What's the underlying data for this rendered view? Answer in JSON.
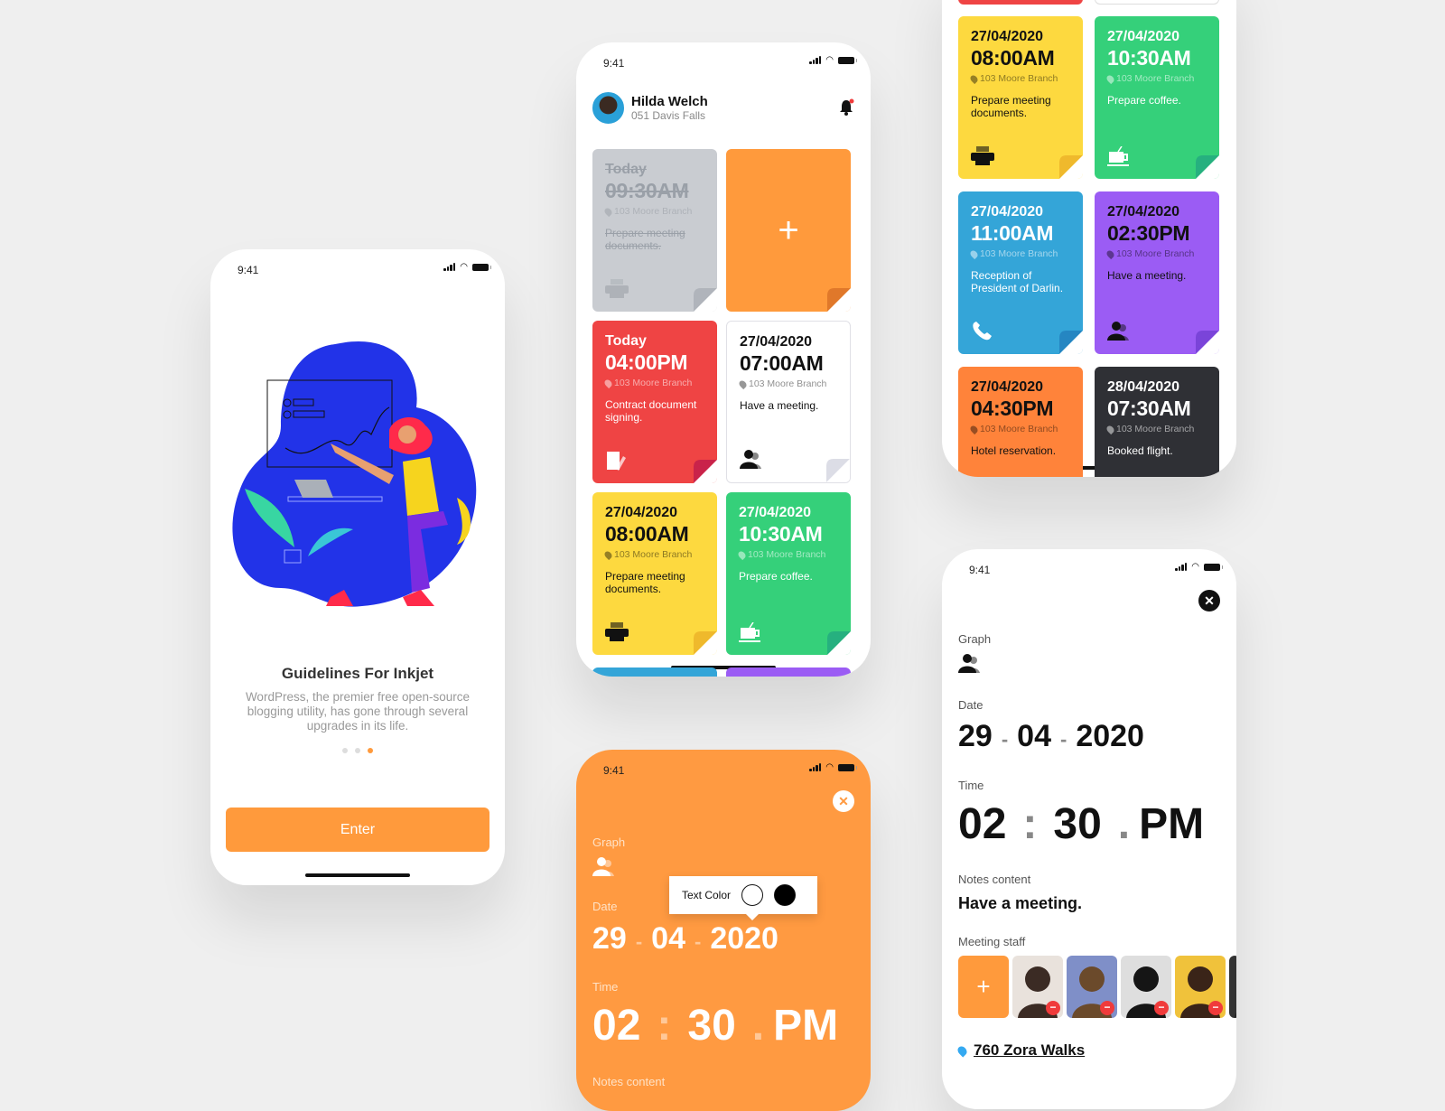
{
  "status_time": "9:41",
  "onboarding": {
    "title": "Guidelines For Inkjet",
    "description": "WordPress, the premier free open-source blogging utility, has gone through several upgrades in its life.",
    "page_indicator": {
      "total": 3,
      "active": 3
    },
    "enter_label": "Enter",
    "accent": "#ff9a3c"
  },
  "home": {
    "user_name": "Hilda Welch",
    "user_address": "051 Davis Falls",
    "notification_badge_color": "#f03b3b",
    "add_label": "+",
    "cards": [
      {
        "date": "Today",
        "time": "09:30AM",
        "location": "103 Moore Branch",
        "note": "Prepare meeting documents.",
        "icon": "printer-icon",
        "bg": "#c9ccd1",
        "fold": "#b0b4bb",
        "fg": "#9aa0a8",
        "done": true
      },
      {
        "date": "Today",
        "time": "04:00PM",
        "location": "103 Moore Branch",
        "note": "Contract document signing.",
        "icon": "document-edit-icon",
        "bg": "#ef4444",
        "fold": "#c9234a",
        "fg": "#ffffff"
      },
      {
        "date": "27/04/2020",
        "time": "07:00AM",
        "location": "103 Moore Branch",
        "note": "Have a meeting.",
        "icon": "people-icon",
        "bg": "#ffffff",
        "fold": "#dcdde6",
        "fg": "#111111"
      },
      {
        "date": "27/04/2020",
        "time": "08:00AM",
        "location": "103 Moore Branch",
        "note": "Prepare meeting documents.",
        "icon": "printer-icon",
        "bg": "#fdd93f",
        "fold": "#efb92c",
        "fg": "#111111"
      },
      {
        "date": "27/04/2020",
        "time": "10:30AM",
        "location": "103 Moore Branch",
        "note": "Prepare coffee.",
        "icon": "coffee-icon",
        "bg": "#35d07a",
        "fold": "#26b07f",
        "fg": "#ffffff"
      }
    ]
  },
  "list": {
    "cards": [
      {
        "date": "27/04/2020",
        "time": "08:00AM",
        "location": "103 Moore Branch",
        "note": "Prepare meeting documents.",
        "icon": "printer-icon",
        "bg": "#fdd93f",
        "fold": "#efb92c",
        "fg": "#111111"
      },
      {
        "date": "27/04/2020",
        "time": "10:30AM",
        "location": "103 Moore Branch",
        "note": "Prepare coffee.",
        "icon": "coffee-icon",
        "bg": "#35d07a",
        "fold": "#26b07f",
        "fg": "#ffffff"
      },
      {
        "date": "27/04/2020",
        "time": "11:00AM",
        "location": "103 Moore Branch",
        "note": "Reception of President of Darlin.",
        "icon": "phone-icon",
        "bg": "#34a5d8",
        "fold": "#2586c2",
        "fg": "#ffffff"
      },
      {
        "date": "27/04/2020",
        "time": "02:30PM",
        "location": "103 Moore Branch",
        "note": "Have a meeting.",
        "icon": "people-icon",
        "bg": "#9b5cf4",
        "fold": "#7a44d9",
        "fg": "#111111"
      },
      {
        "date": "27/04/2020",
        "time": "04:30PM",
        "location": "103 Moore Branch",
        "note": "Hotel reservation.",
        "icon": "",
        "bg": "#ff833a",
        "fold": "#e56b2a",
        "fg": "#111111"
      },
      {
        "date": "28/04/2020",
        "time": "07:30AM",
        "location": "103 Moore Branch",
        "note": "Booked flight.",
        "icon": "",
        "bg": "#2f3035",
        "fold": "#222",
        "fg": "#ffffff"
      }
    ]
  },
  "edit_orange": {
    "graph_label": "Graph",
    "date_label": "Date",
    "date": {
      "day": "29",
      "month": "04",
      "year": "2020"
    },
    "time_label": "Time",
    "time": {
      "hour": "02",
      "minute": "30",
      "period": "PM"
    },
    "notes_label": "Notes content",
    "popup_label": "Text Color",
    "color_options": [
      "#ffffff",
      "#000000"
    ]
  },
  "edit_white": {
    "graph_label": "Graph",
    "date_label": "Date",
    "date": {
      "day": "29",
      "month": "04",
      "year": "2020"
    },
    "time_label": "Time",
    "time": {
      "hour": "02",
      "minute": "30",
      "period": "PM"
    },
    "notes_label": "Notes content",
    "notes": "Have a meeting.",
    "staff_label": "Meeting staff",
    "staff_add": "+",
    "staff": [
      {
        "name": "Staff 1",
        "color": "#3b2b24",
        "bg": "#e9e2dc"
      },
      {
        "name": "Staff 2",
        "color": "#6b4a2b",
        "bg": "#7f8fc8"
      },
      {
        "name": "Staff 3",
        "color": "#151515",
        "bg": "#dedede"
      },
      {
        "name": "Staff 4",
        "color": "#3a2418",
        "bg": "#f0c23b"
      },
      {
        "name": "Staff 5",
        "color": "#222",
        "bg": "#333"
      }
    ],
    "address": "760 Zora Walks"
  }
}
